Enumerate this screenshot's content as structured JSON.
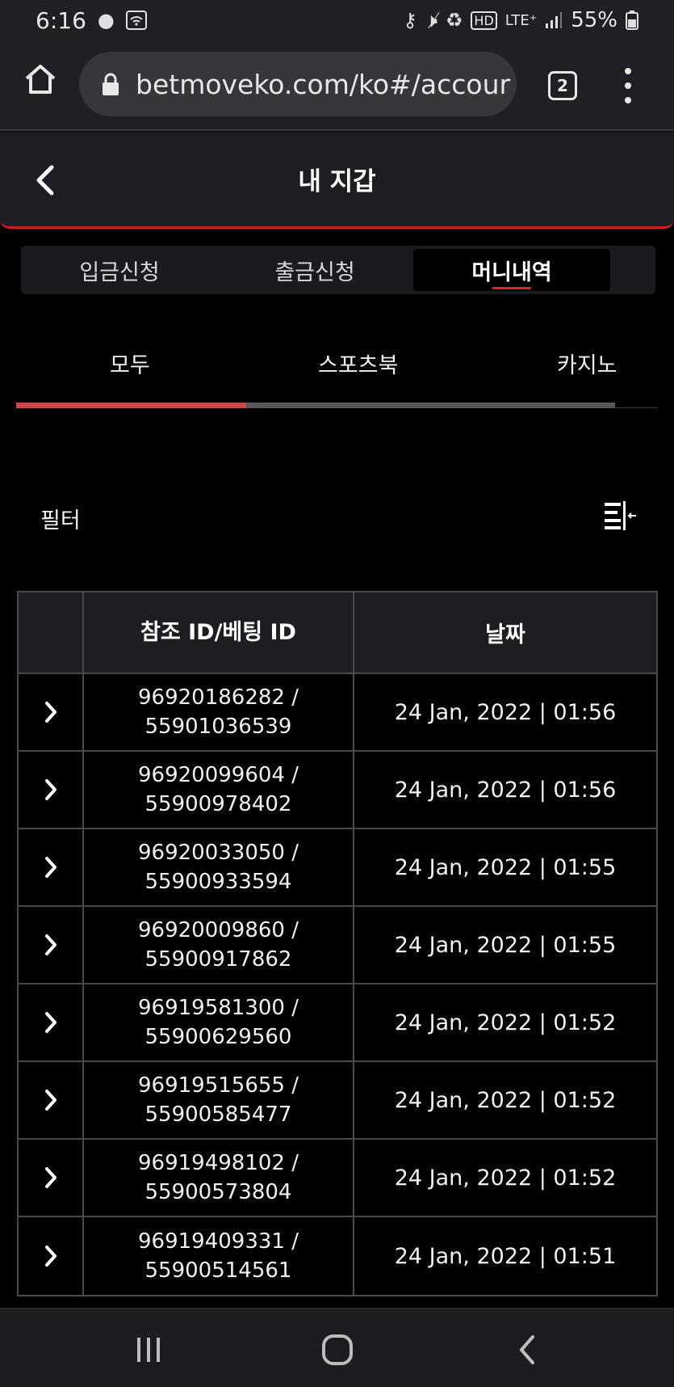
{
  "status_bar": {
    "time": "6:16",
    "lte_label": "LTE⁺",
    "battery": "55%",
    "hd_label": "HD"
  },
  "browser": {
    "url": "betmoveko.com/ko#/accour",
    "tab_count": "2"
  },
  "header": {
    "title": "내 지갑"
  },
  "main_tabs": [
    {
      "label": "입금신청",
      "active": false
    },
    {
      "label": "출금신청",
      "active": false
    },
    {
      "label": "머니내역",
      "active": true
    }
  ],
  "sub_tabs": [
    {
      "label": "모두",
      "active": true
    },
    {
      "label": "스포츠북",
      "active": false
    },
    {
      "label": "카지노",
      "active": false
    }
  ],
  "filter": {
    "label": "필터"
  },
  "table": {
    "columns": [
      "",
      "참조 ID/베팅 ID",
      "날짜"
    ],
    "rows": [
      {
        "ref_id": "96920186282 /",
        "bet_id": "55901036539",
        "date": "24 Jan, 2022 | 01:56"
      },
      {
        "ref_id": "96920099604 /",
        "bet_id": "55900978402",
        "date": "24 Jan, 2022 | 01:56"
      },
      {
        "ref_id": "96920033050 /",
        "bet_id": "55900933594",
        "date": "24 Jan, 2022 | 01:55"
      },
      {
        "ref_id": "96920009860 /",
        "bet_id": "55900917862",
        "date": "24 Jan, 2022 | 01:55"
      },
      {
        "ref_id": "96919581300 /",
        "bet_id": "55900629560",
        "date": "24 Jan, 2022 | 01:52"
      },
      {
        "ref_id": "96919515655 /",
        "bet_id": "55900585477",
        "date": "24 Jan, 2022 | 01:52"
      },
      {
        "ref_id": "96919498102 /",
        "bet_id": "55900573804",
        "date": "24 Jan, 2022 | 01:52"
      },
      {
        "ref_id": "96919409331 /",
        "bet_id": "55900514561",
        "date": "24 Jan, 2022 | 01:51"
      }
    ]
  },
  "colors": {
    "accent_red": "#d01f25",
    "header_bg": "#1d1e22",
    "border": "#4a4a4c"
  }
}
